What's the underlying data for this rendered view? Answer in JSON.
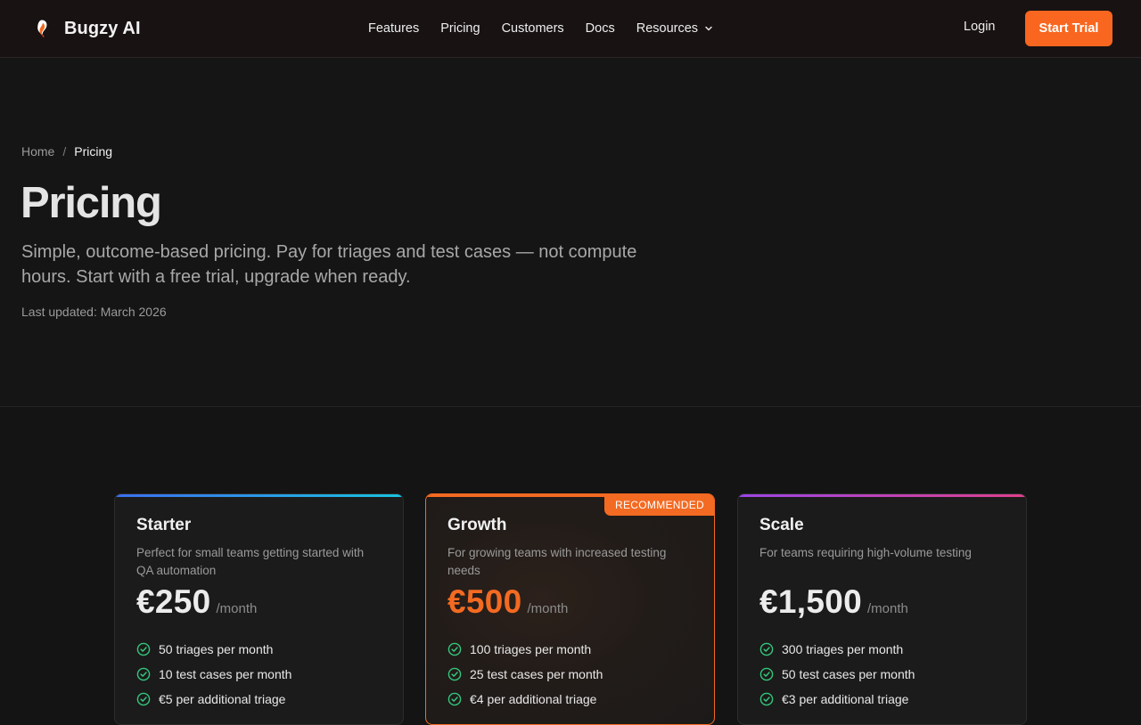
{
  "nav": {
    "brand": "Bugzy AI",
    "links": [
      "Features",
      "Pricing",
      "Customers",
      "Docs"
    ],
    "resources_label": "Resources",
    "login_label": "Login",
    "cta_label": "Start Trial",
    "icons": {
      "logo": "bugzy-logo-icon",
      "dropdown": "chevron-down-icon"
    }
  },
  "breadcrumb": {
    "home": "Home",
    "separator": "/",
    "current": "Pricing"
  },
  "hero": {
    "title": "Pricing",
    "subtitle": "Simple, outcome-based pricing. Pay for triages and test cases — not compute hours. Start with a free trial, upgrade when ready.",
    "updated": "Last updated: March 2026"
  },
  "plans": [
    {
      "name": "Starter",
      "description": "Perfect for small teams getting started with QA automation",
      "price": "€250",
      "period": "/month",
      "features": [
        "50 triages per month",
        "10 test cases per month",
        "€5 per additional triage"
      ]
    },
    {
      "name": "Growth",
      "badge": "RECOMMENDED",
      "description": "For growing teams with increased testing needs",
      "price": "€500",
      "period": "/month",
      "features": [
        "100 triages per month",
        "25 test cases per month",
        "€4 per additional triage"
      ]
    },
    {
      "name": "Scale",
      "description": "For teams requiring high-volume testing",
      "price": "€1,500",
      "period": "/month",
      "features": [
        "300 triages per month",
        "50 test cases per month",
        "€3 per additional triage"
      ]
    }
  ],
  "colors": {
    "accent": "#f9661f",
    "background": "#141414",
    "check": "#34c77b",
    "starter_gradient": [
      "#3b6ff0",
      "#18c3e0"
    ],
    "scale_gradient": [
      "#9b45e6",
      "#e0408c"
    ]
  },
  "feature_icon": "check-circle-icon"
}
